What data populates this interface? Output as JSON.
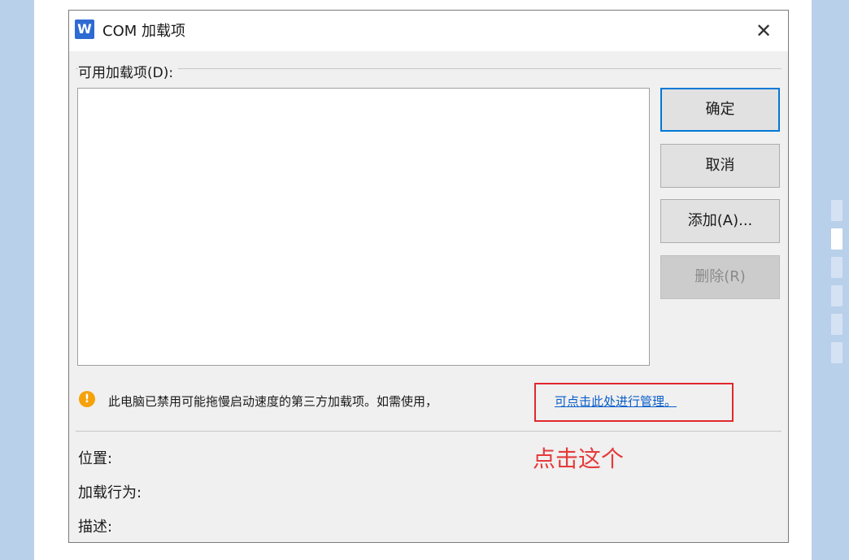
{
  "dialog": {
    "app_icon_letter": "W",
    "title": "COM 加载项",
    "close_glyph": "✕",
    "available_label": "可用加载项(D):"
  },
  "buttons": {
    "ok": "确定",
    "cancel": "取消",
    "add": "添加(A)...",
    "remove": "删除(R)"
  },
  "notice": {
    "icon_glyph": "!",
    "text": "此电脑已禁用可能拖慢启动速度的第三方加载项。如需使用，",
    "link": "可点击此处进行管理。"
  },
  "annotation": "点击这个",
  "info": {
    "location": "位置:",
    "load_behavior": "加载行为:",
    "description": "描述:"
  },
  "colors": {
    "accent": "#0078d7",
    "link": "#0a5ec9",
    "annotation_red": "#e0282c",
    "warning": "#f5a20a",
    "background": "#b9d0ea"
  }
}
